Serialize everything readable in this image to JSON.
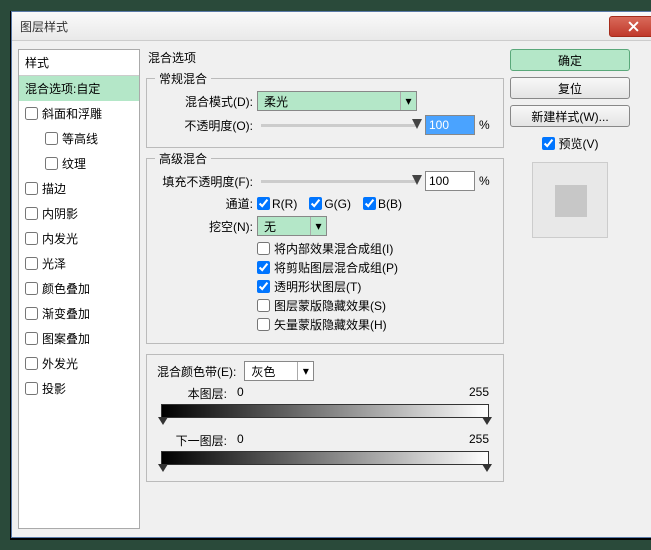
{
  "window": {
    "title": "图层样式"
  },
  "styles": {
    "header": "样式",
    "blend_options": "混合选项:自定",
    "items": {
      "bevel": "斜面和浮雕",
      "contour": "等高线",
      "texture": "纹理",
      "stroke": "描边",
      "inner_shadow": "内阴影",
      "inner_glow": "内发光",
      "satin": "光泽",
      "color_overlay": "颜色叠加",
      "gradient_overlay": "渐变叠加",
      "pattern_overlay": "图案叠加",
      "outer_glow": "外发光",
      "drop_shadow": "投影"
    }
  },
  "blend": {
    "heading": "混合选项",
    "general": {
      "title": "常规混合",
      "mode_label": "混合模式(D):",
      "mode_value": "柔光",
      "opacity_label": "不透明度(O):",
      "opacity_value": "100",
      "pct": "%"
    },
    "advanced": {
      "title": "高级混合",
      "fill_label": "填充不透明度(F):",
      "fill_value": "100",
      "pct": "%",
      "channel_label": "通道:",
      "R": "R(R)",
      "G": "G(G)",
      "B": "B(B)",
      "knockout_label": "挖空(N):",
      "knockout_value": "无",
      "opt1": "将内部效果混合成组(I)",
      "opt2": "将剪贴图层混合成组(P)",
      "opt3": "透明形状图层(T)",
      "opt4": "图层蒙版隐藏效果(S)",
      "opt5": "矢量蒙版隐藏效果(H)"
    },
    "blendif": {
      "title": "混合颜色带(E):",
      "value": "灰色",
      "this_layer": "本图层:",
      "under_layer": "下一图层:",
      "lo": "0",
      "hi": "255"
    }
  },
  "buttons": {
    "ok": "确定",
    "reset": "复位",
    "new_style": "新建样式(W)...",
    "preview": "预览(V)"
  }
}
